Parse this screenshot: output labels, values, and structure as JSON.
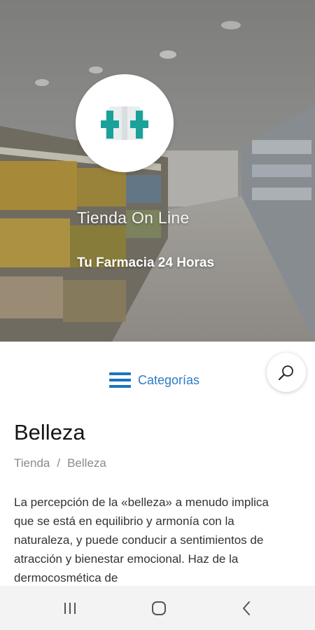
{
  "hero": {
    "title": "Tienda On Line",
    "subtitle": "Tu Farmacia 24 Horas",
    "logo_icon": "pharmacy-cross-logo-icon"
  },
  "categories": {
    "label": "Categorías",
    "icon": "hamburger-menu-icon"
  },
  "search": {
    "icon": "search-icon"
  },
  "page": {
    "title": "Belleza",
    "breadcrumb": [
      "Tienda",
      "Belleza"
    ],
    "breadcrumb_separator": "/",
    "description": "La percepción de la «belleza» a menudo implica que se está en equilibrio y armonía con la naturaleza, y puede conducir a sentimientos de atracción y bienestar emocional. Haz de la dermocosmética de"
  },
  "navbar": {
    "recent_icon": "recent-apps-icon",
    "home_icon": "home-icon",
    "back_icon": "back-icon"
  },
  "colors": {
    "accent": "#1e73be",
    "logo_teal": "#1aa19a"
  }
}
